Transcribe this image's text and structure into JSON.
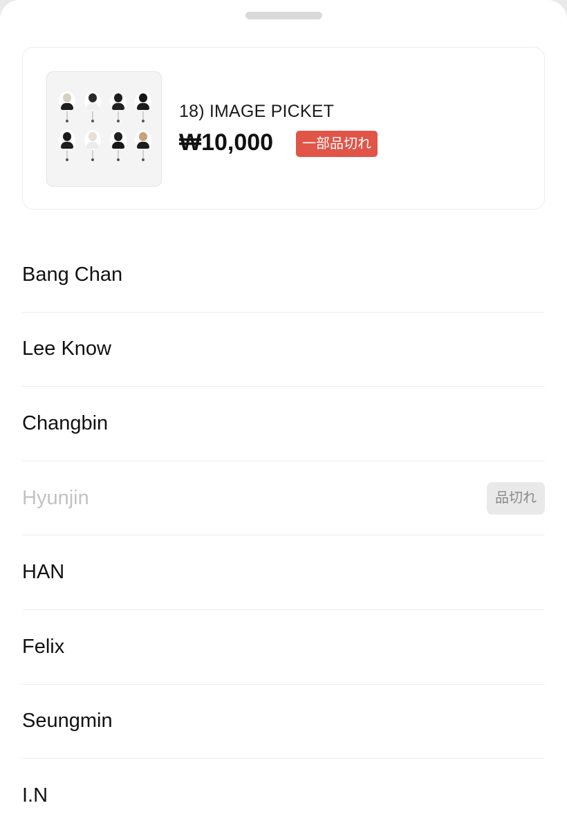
{
  "product": {
    "name": "18) IMAGE PICKET",
    "price": "₩10,000",
    "stock_badge": "一部品切れ",
    "stock_badge_color": "#e05548",
    "image_icon": "picket-photo-set-icon"
  },
  "options": [
    {
      "label": "Bang Chan",
      "sold_out": false,
      "badge": ""
    },
    {
      "label": "Lee Know",
      "sold_out": false,
      "badge": ""
    },
    {
      "label": "Changbin",
      "sold_out": false,
      "badge": ""
    },
    {
      "label": "Hyunjin",
      "sold_out": true,
      "badge": "品切れ"
    },
    {
      "label": "HAN",
      "sold_out": false,
      "badge": ""
    },
    {
      "label": "Felix",
      "sold_out": false,
      "badge": ""
    },
    {
      "label": "Seungmin",
      "sold_out": false,
      "badge": ""
    },
    {
      "label": "I.N",
      "sold_out": false,
      "badge": ""
    }
  ],
  "colors": {
    "sold_out_badge_bg": "#e9e9e9",
    "disabled_text": "#c2c2c2"
  }
}
